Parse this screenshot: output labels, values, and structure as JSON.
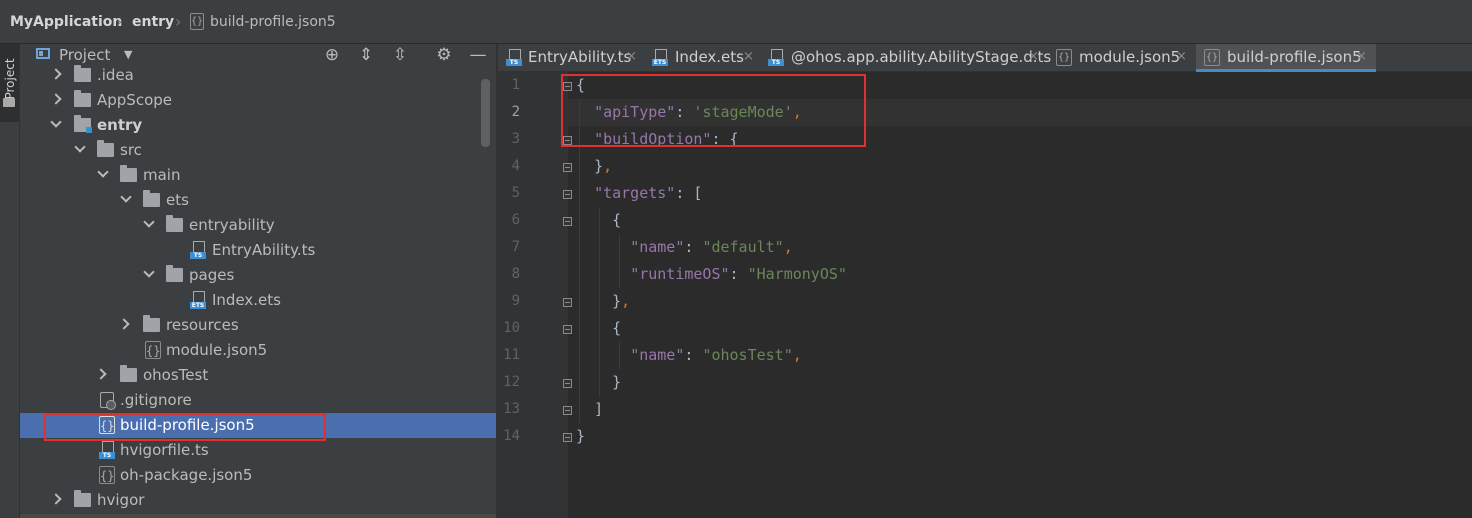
{
  "breadcrumb": {
    "items": [
      "MyApplication",
      "entry",
      "build-profile.json5"
    ]
  },
  "side_strip": {
    "label": "Project"
  },
  "project_panel": {
    "title": "Project",
    "tree": [
      {
        "label": ".idea",
        "kind": "folder"
      },
      {
        "label": "AppScope",
        "kind": "folder"
      },
      {
        "label": "entry",
        "kind": "module"
      },
      {
        "label": "src",
        "kind": "folder"
      },
      {
        "label": "main",
        "kind": "folder"
      },
      {
        "label": "ets",
        "kind": "folder"
      },
      {
        "label": "entryability",
        "kind": "folder"
      },
      {
        "label": "EntryAbility.ts",
        "kind": "ts"
      },
      {
        "label": "pages",
        "kind": "folder"
      },
      {
        "label": "Index.ets",
        "kind": "ets"
      },
      {
        "label": "resources",
        "kind": "folder"
      },
      {
        "label": "module.json5",
        "kind": "json"
      },
      {
        "label": "ohosTest",
        "kind": "folder"
      },
      {
        "label": ".gitignore",
        "kind": "git"
      },
      {
        "label": "build-profile.json5",
        "kind": "json",
        "selected": true
      },
      {
        "label": "hvigorfile.ts",
        "kind": "ts"
      },
      {
        "label": "oh-package.json5",
        "kind": "json"
      },
      {
        "label": "hvigor",
        "kind": "folder"
      }
    ]
  },
  "tabs": [
    {
      "label": "EntryAbility.ts",
      "icon": "ts-file-icon",
      "close": "×"
    },
    {
      "label": "Index.ets",
      "icon": "ets-file-icon",
      "close": "×"
    },
    {
      "label": "@ohos.app.ability.AbilityStage.d.ts",
      "icon": "ts-file-icon",
      "close": "×"
    },
    {
      "label": "module.json5",
      "icon": "json-file-icon",
      "close": "×"
    },
    {
      "label": "build-profile.json5",
      "icon": "json-file-icon",
      "close": "×",
      "active": true
    }
  ],
  "editor": {
    "line_numbers": [
      "1",
      "2",
      "3",
      "4",
      "5",
      "6",
      "7",
      "8",
      "9",
      "10",
      "11",
      "12",
      "13",
      "14"
    ],
    "current_line": 2,
    "lines": {
      "l1_brace": "{",
      "l2_key": "\"apiType\"",
      "l2_colon": ": ",
      "l2_val": "'stageMode'",
      "l2_comma": ",",
      "l3_key": "\"buildOption\"",
      "l3_colon": ": ",
      "l3_brace": "{",
      "l4_brace": "}",
      "l4_comma": ",",
      "l5_key": "\"targets\"",
      "l5_colon": ": ",
      "l5_bracket": "[",
      "l6_brace": "{",
      "l7_key": "\"name\"",
      "l7_colon": ": ",
      "l7_val": "\"default\"",
      "l7_comma": ",",
      "l8_key": "\"runtimeOS\"",
      "l8_colon": ": ",
      "l8_val": "\"HarmonyOS\"",
      "l9_brace": "}",
      "l9_comma": ",",
      "l10_brace": "{",
      "l11_key": "\"name\"",
      "l11_colon": ": ",
      "l11_val": "\"ohosTest\"",
      "l11_comma": ",",
      "l12_brace": "}",
      "l13_bracket": "]",
      "l14_brace": "}"
    }
  },
  "colors": {
    "highlight_box": "#e03030",
    "selection": "#4b6eaf",
    "json_key": "#9876aa",
    "json_string": "#6a8759"
  }
}
